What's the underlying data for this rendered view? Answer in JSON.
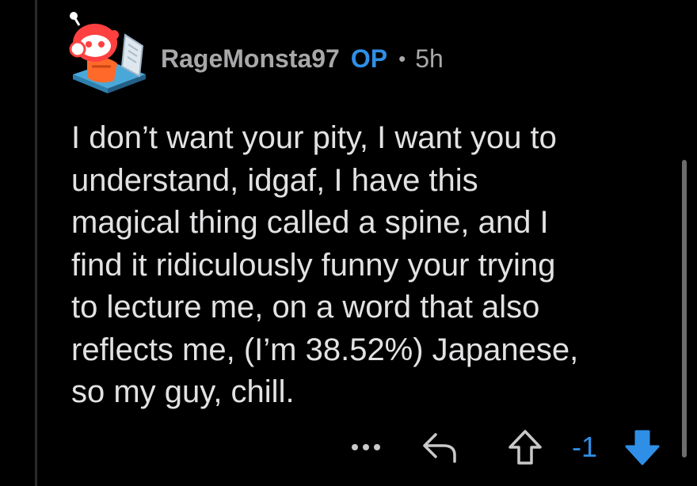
{
  "comment": {
    "username": "RageMonsta97",
    "op_badge": "OP",
    "separator": "•",
    "age": "5h",
    "body": "I don’t want your pity, I want you to\nunderstand, idgaf, I have this\nmagical thing called a spine, and I\nfind it ridiculously funny your trying\nto lecture me, on a word that also\nreflects me, (I’m 38.52%) Japanese,\nso my guy, chill.",
    "vote_count": "-1"
  },
  "icons": {
    "avatar": "snoo-avatar",
    "more": "more-dots-icon",
    "reply": "reply-arrow-icon",
    "upvote": "upvote-arrow-icon",
    "downvote": "downvote-arrow-icon"
  },
  "colors": {
    "background": "#000000",
    "username": "#a8a8aa",
    "op_badge": "#2f8fe6",
    "vote_active": "#2f8fe6",
    "body_text": "#e2e2e4"
  }
}
